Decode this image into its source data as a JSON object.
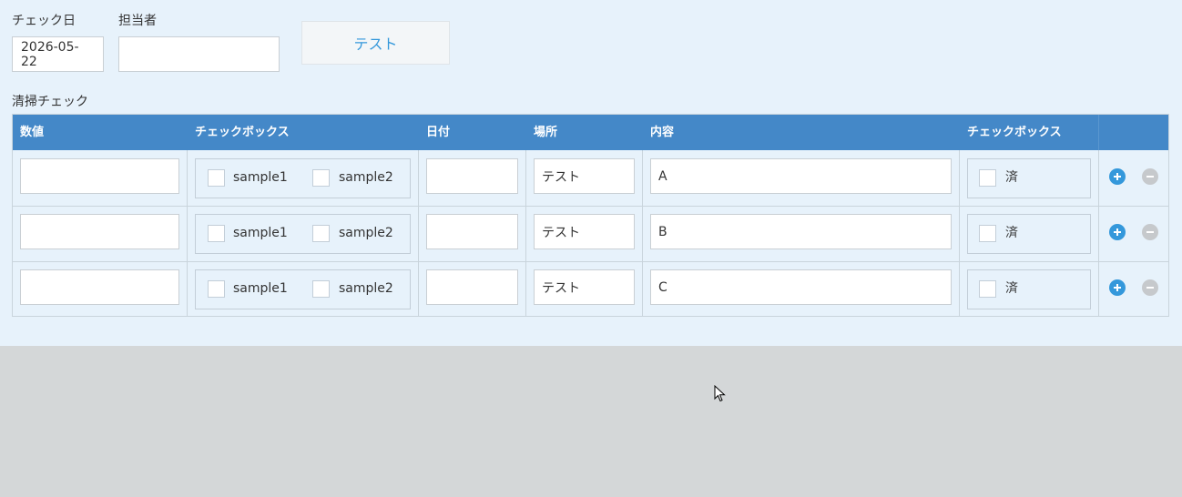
{
  "header": {
    "check_date_label": "チェック日",
    "check_date_value": "2026-05-22",
    "person_label": "担当者",
    "person_value": "",
    "test_button_label": "テスト"
  },
  "section_title": "清掃チェック",
  "table": {
    "columns": [
      "数値",
      "チェックボックス",
      "日付",
      "場所",
      "内容",
      "チェックボックス"
    ],
    "rows": [
      {
        "number": "",
        "option1": "sample1",
        "option2": "sample2",
        "date": "",
        "place": "テスト",
        "content": "A",
        "done_label": "済"
      },
      {
        "number": "",
        "option1": "sample1",
        "option2": "sample2",
        "date": "",
        "place": "テスト",
        "content": "B",
        "done_label": "済"
      },
      {
        "number": "",
        "option1": "sample1",
        "option2": "sample2",
        "date": "",
        "place": "テスト",
        "content": "C",
        "done_label": "済"
      }
    ]
  },
  "icons": {
    "add": "plus-circle-icon",
    "remove": "minus-circle-icon",
    "cursor": "mouse-pointer-icon"
  },
  "colors": {
    "header_bg": "#4488c8",
    "accent": "#3498db",
    "panel_bg": "#e7f2fb",
    "page_bg": "#d4d7d8"
  }
}
